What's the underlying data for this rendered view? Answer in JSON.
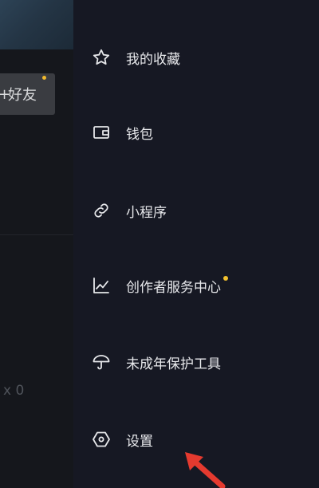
{
  "background_page": {
    "add_friend_label": "好友",
    "follow_count": "0"
  },
  "drawer": {
    "items": [
      {
        "id": "favorites",
        "label": "我的收藏",
        "icon": "star-icon"
      },
      {
        "id": "wallet",
        "label": "钱包",
        "icon": "wallet-icon"
      },
      {
        "id": "mini_programs",
        "label": "小程序",
        "icon": "link-icon"
      },
      {
        "id": "creator_center",
        "label": "创作者服务中心",
        "icon": "trend-chart-icon",
        "has_dot": true
      },
      {
        "id": "minor_protection",
        "label": "未成年保护工具",
        "icon": "umbrella-icon"
      },
      {
        "id": "settings",
        "label": "设置",
        "icon": "hexagon-settings-icon"
      }
    ]
  },
  "colors": {
    "drawer_bg": "#161823",
    "notification_dot": "#f3c12e",
    "annotation_arrow": "#e53a2f"
  }
}
